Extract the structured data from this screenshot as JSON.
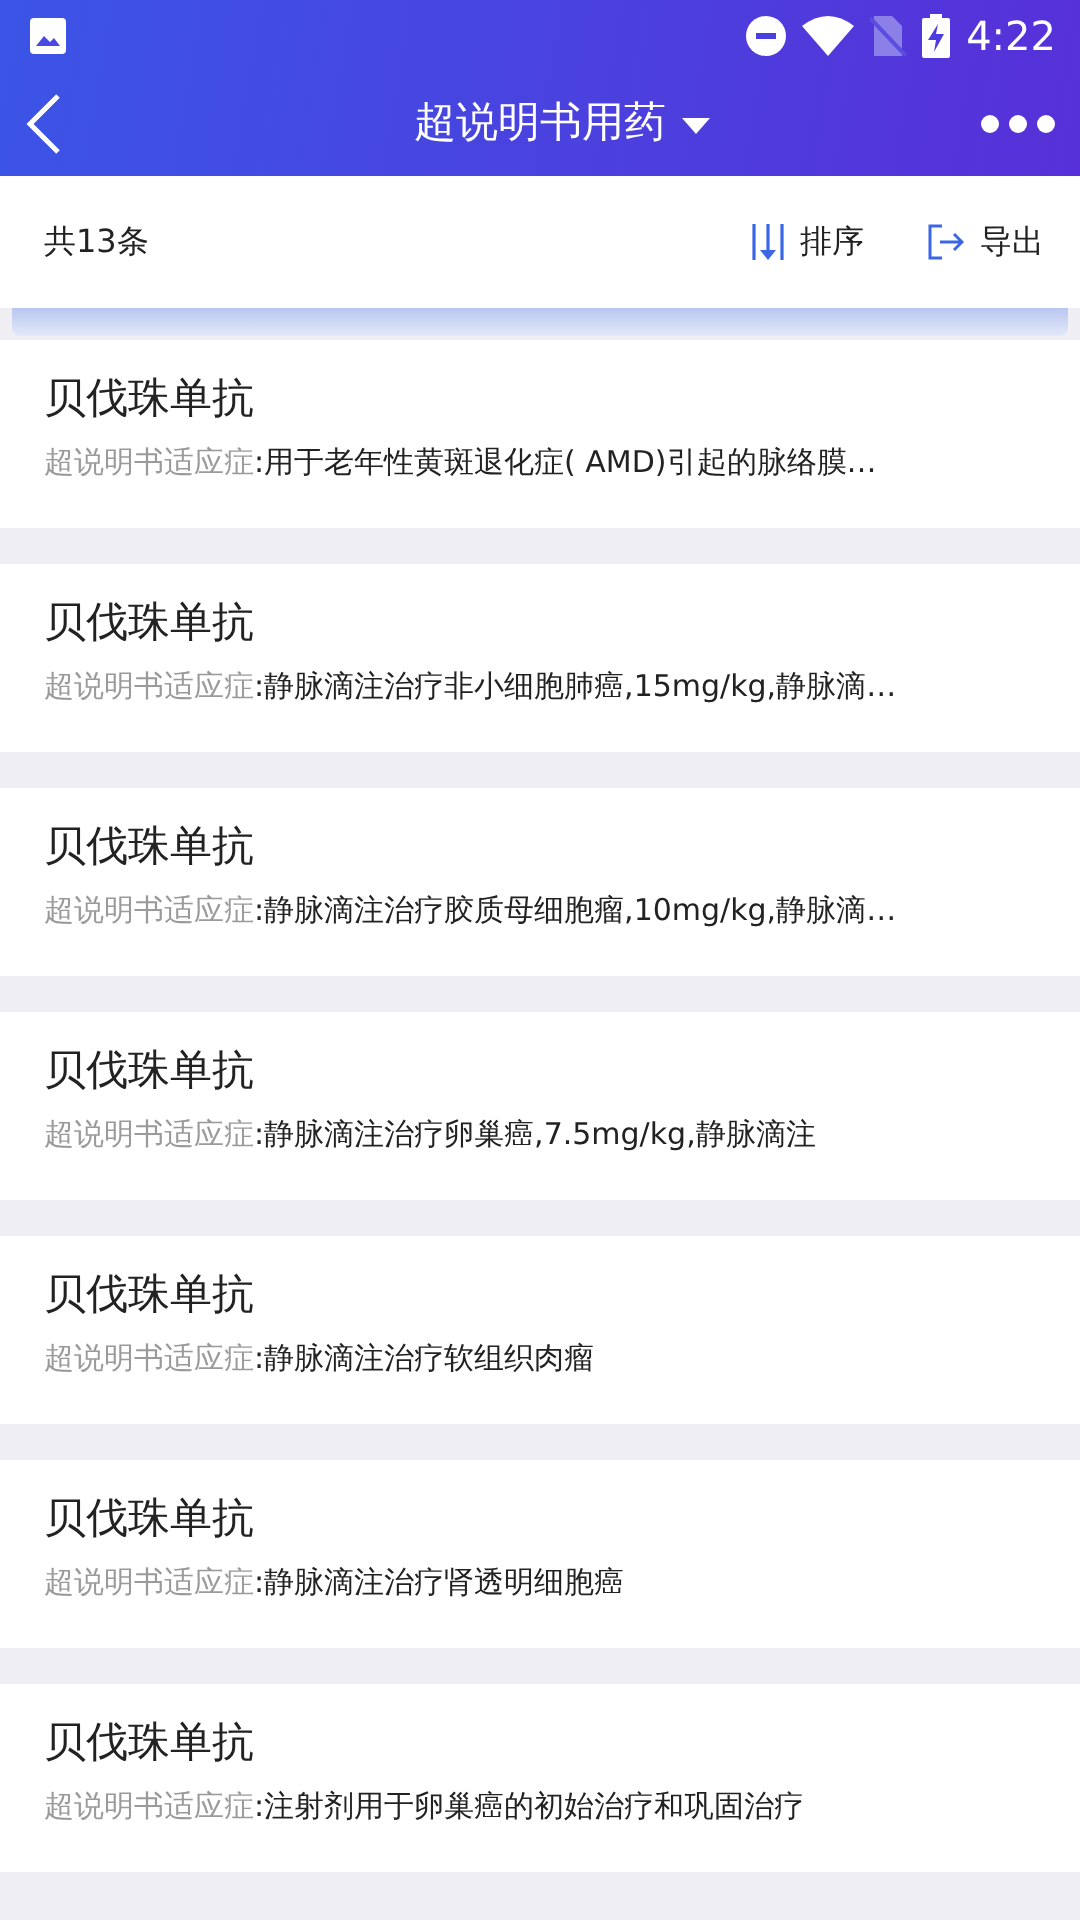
{
  "status_bar": {
    "time": "4:22"
  },
  "header": {
    "title": "超说明书用药"
  },
  "toolbar": {
    "count": "共13条",
    "actions": [
      {
        "kind": "sort",
        "label": "排序"
      },
      {
        "kind": "export",
        "label": "导出"
      }
    ]
  },
  "items": [
    {
      "name": "贝伐珠单抗",
      "label": "超说明书适应症",
      "value": ":用于老年性黄斑退化症( AMD)引起的脉络膜…"
    },
    {
      "name": "贝伐珠单抗",
      "label": "超说明书适应症",
      "value": ":静脉滴注治疗非小细胞肺癌,15mg/kg,静脉滴…"
    },
    {
      "name": "贝伐珠单抗",
      "label": "超说明书适应症",
      "value": ":静脉滴注治疗胶质母细胞瘤,10mg/kg,静脉滴…"
    },
    {
      "name": "贝伐珠单抗",
      "label": "超说明书适应症",
      "value": ":静脉滴注治疗卵巢癌,7.5mg/kg,静脉滴注"
    },
    {
      "name": "贝伐珠单抗",
      "label": "超说明书适应症",
      "value": ":静脉滴注治疗软组织肉瘤"
    },
    {
      "name": "贝伐珠单抗",
      "label": "超说明书适应症",
      "value": ":静脉滴注治疗肾透明细胞癌"
    },
    {
      "name": "贝伐珠单抗",
      "label": "超说明书适应症",
      "value": ":注射剂用于卵巢癌的初始治疗和巩固治疗"
    }
  ]
}
